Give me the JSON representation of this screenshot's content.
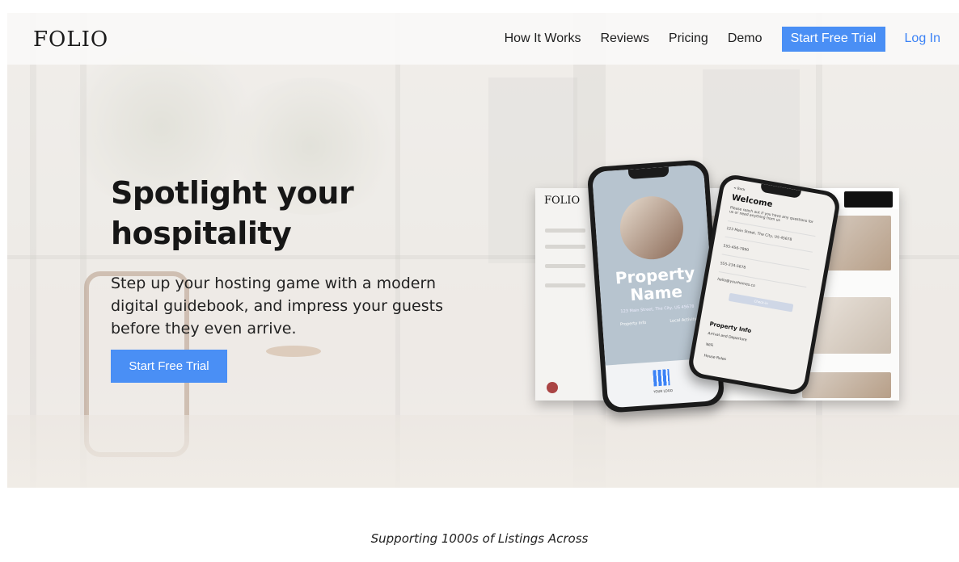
{
  "nav": {
    "logo": "FOLIO",
    "links": [
      "How It Works",
      "Reviews",
      "Pricing",
      "Demo"
    ],
    "cta": "Start Free Trial",
    "login": "Log In"
  },
  "hero": {
    "headline": "Spotlight your hospitality",
    "subtext": "Step up your hosting game with a modern digital guidebook, and impress your guests before they even arrive.",
    "cta": "Start Free Trial"
  },
  "mockup": {
    "desktop_logo": "FOLIO",
    "phone_left": {
      "title": "Property Name",
      "address": "123 Main Street, The City, US 45678",
      "buttons": [
        "Property Info",
        "Local Activities"
      ],
      "qr_label": "YOUR LOGO"
    },
    "phone_right": {
      "back": "< Back",
      "title": "Welcome",
      "intro": "Please reach out if you have any questions for us or need anything from us",
      "address": "123 Main Street, The City, US 45678",
      "phone1": "555-456-7890",
      "phone2": "555-234-5678",
      "email": "hello@yourhomes.co",
      "button": "Check-in",
      "section": "Property Info",
      "items": [
        "Arrival and Departure",
        "WiFi",
        "House Rules"
      ]
    }
  },
  "footer_tagline": "Supporting 1000s of Listings Across",
  "colors": {
    "accent": "#4a8ff5",
    "link": "#3b82f6"
  }
}
